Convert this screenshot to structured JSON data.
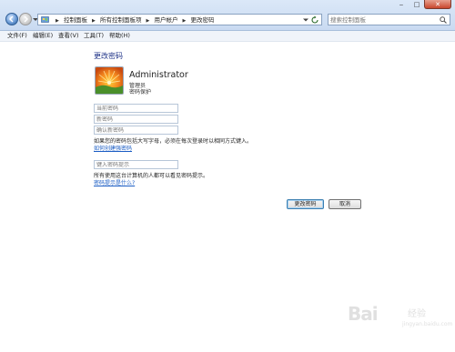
{
  "address_bar": {
    "breadcrumbs": [
      "控制面板",
      "所有控制面板项",
      "用户帐户",
      "更改密码"
    ],
    "search_placeholder": "搜索控制面板"
  },
  "window_controls": {
    "minimize": "‒",
    "maximize": "□",
    "close": "✕"
  },
  "menu": {
    "items": [
      "文件(F)",
      "编辑(E)",
      "查看(V)",
      "工具(T)",
      "帮助(H)"
    ]
  },
  "page": {
    "title": "更改密码",
    "user": {
      "name": "Administrator",
      "role": "管理员",
      "status": "密码保护"
    },
    "fields": {
      "current_password": "当前密码",
      "new_password": "新密码",
      "confirm_password": "确认新密码",
      "password_hint": "键入密码提示"
    },
    "caps_note": "如果您的密码包括大写字母，必须在每次登录时以相同方式键入。",
    "strong_password_link": "如何创建强密码",
    "hint_note": "所有使用这台计算机的人都可以看见密码提示。",
    "hint_link": "密码提示是什么?",
    "buttons": {
      "change": "更改密码",
      "cancel": "取消"
    }
  },
  "watermark": {
    "brand": "Bai",
    "sub": "经验",
    "url": "jingyan.baidu.com"
  },
  "colors": {
    "title": "#1e3287",
    "link": "#1b5dc4",
    "addrbar": "#dbe8f8"
  },
  "icons": [
    "back-arrow-icon",
    "forward-arrow-icon",
    "control-panel-icon",
    "refresh-icon",
    "search-icon",
    "user-flower-avatar"
  ]
}
